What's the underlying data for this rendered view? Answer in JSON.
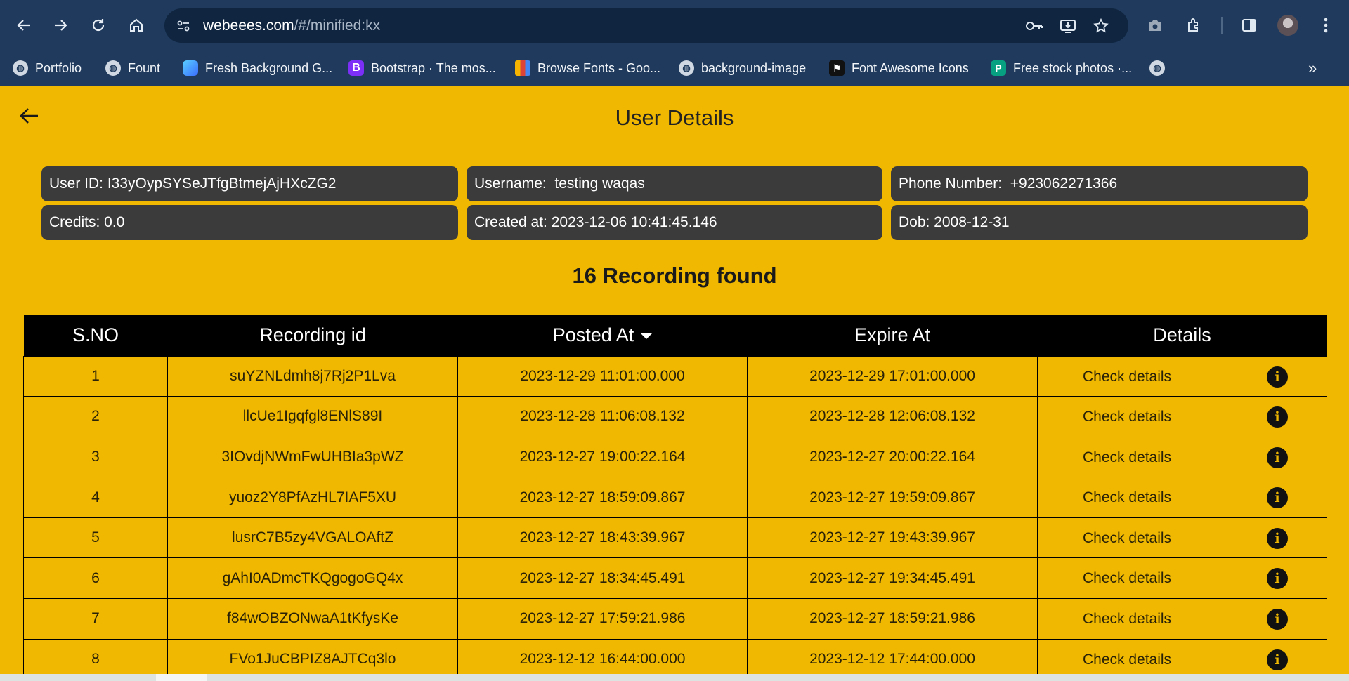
{
  "browser": {
    "url_host": "webeees.com",
    "url_path": "/#/minified:kx",
    "bookmarks": [
      {
        "label": "Portfolio",
        "icon": "globe-icon"
      },
      {
        "label": "Fount",
        "icon": "globe-icon"
      },
      {
        "label": "Fresh Background G...",
        "icon": "gradient-icon"
      },
      {
        "label": "Bootstrap · The mos...",
        "icon": "bootstrap-icon"
      },
      {
        "label": "Browse Fonts - Goo...",
        "icon": "google-fonts-icon"
      },
      {
        "label": "background-image",
        "icon": "globe-icon"
      },
      {
        "label": "Font Awesome Icons",
        "icon": "flag-icon"
      },
      {
        "label": "Free stock photos ·...",
        "icon": "pexels-icon"
      }
    ]
  },
  "page": {
    "title": "User Details",
    "user": {
      "user_id": "User ID: I33yOypSYSeJTfgBtmejAjHXcZG2",
      "username": "Username:  testing waqas",
      "phone": "Phone Number:  +923062271366",
      "credits": "Credits: 0.0",
      "created_at": "Created at: 2023-12-06 10:41:45.146",
      "dob": "Dob: 2008-12-31"
    },
    "recordings_count": "16 Recording found",
    "table": {
      "headers": [
        "S.NO",
        "Recording id",
        "Posted At",
        "Expire At",
        "Details"
      ],
      "check_label": "Check details",
      "rows": [
        {
          "sno": "1",
          "id": "suYZNLdmh8j7Rj2P1Lva",
          "posted": "2023-12-29 11:01:00.000",
          "expire": "2023-12-29 17:01:00.000"
        },
        {
          "sno": "2",
          "id": "llcUe1Igqfgl8ENlS89I",
          "posted": "2023-12-28 11:06:08.132",
          "expire": "2023-12-28 12:06:08.132"
        },
        {
          "sno": "3",
          "id": "3IOvdjNWmFwUHBIa3pWZ",
          "posted": "2023-12-27 19:00:22.164",
          "expire": "2023-12-27 20:00:22.164"
        },
        {
          "sno": "4",
          "id": "yuoz2Y8PfAzHL7IAF5XU",
          "posted": "2023-12-27 18:59:09.867",
          "expire": "2023-12-27 19:59:09.867"
        },
        {
          "sno": "5",
          "id": "lusrC7B5zy4VGALOAftZ",
          "posted": "2023-12-27 18:43:39.967",
          "expire": "2023-12-27 19:43:39.967"
        },
        {
          "sno": "6",
          "id": "gAhI0ADmcTKQgogoGQ4x",
          "posted": "2023-12-27 18:34:45.491",
          "expire": "2023-12-27 19:34:45.491"
        },
        {
          "sno": "7",
          "id": "f84wOBZONwaA1tKfysKe",
          "posted": "2023-12-27 17:59:21.986",
          "expire": "2023-12-27 18:59:21.986"
        },
        {
          "sno": "8",
          "id": "FVo1JuCBPIZ8AJTCq3lo",
          "posted": "2023-12-12 16:44:00.000",
          "expire": "2023-12-12 17:44:00.000"
        }
      ]
    }
  },
  "colors": {
    "page_background": "#f0b800",
    "card_background": "#3b3b3b",
    "table_header": "#000000",
    "browser_chrome": "#1f3a5c"
  }
}
